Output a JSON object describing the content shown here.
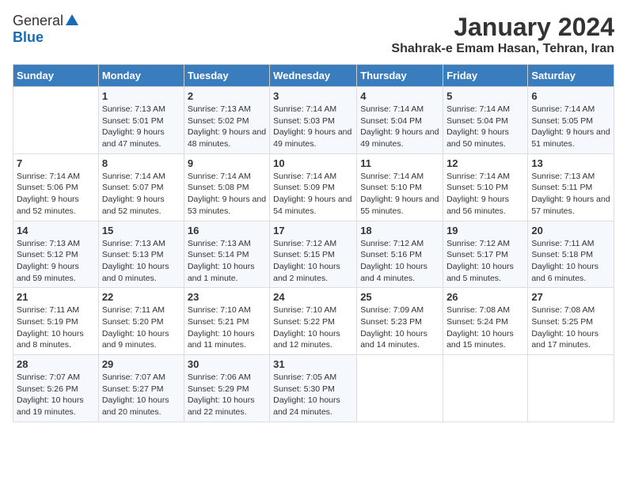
{
  "logo": {
    "general": "General",
    "blue": "Blue"
  },
  "title": "January 2024",
  "subtitle": "Shahrak-e Emam Hasan, Tehran, Iran",
  "days_header": [
    "Sunday",
    "Monday",
    "Tuesday",
    "Wednesday",
    "Thursday",
    "Friday",
    "Saturday"
  ],
  "weeks": [
    [
      {
        "day": "",
        "sunrise": "",
        "sunset": "",
        "daylight": ""
      },
      {
        "day": "1",
        "sunrise": "Sunrise: 7:13 AM",
        "sunset": "Sunset: 5:01 PM",
        "daylight": "Daylight: 9 hours and 47 minutes."
      },
      {
        "day": "2",
        "sunrise": "Sunrise: 7:13 AM",
        "sunset": "Sunset: 5:02 PM",
        "daylight": "Daylight: 9 hours and 48 minutes."
      },
      {
        "day": "3",
        "sunrise": "Sunrise: 7:14 AM",
        "sunset": "Sunset: 5:03 PM",
        "daylight": "Daylight: 9 hours and 49 minutes."
      },
      {
        "day": "4",
        "sunrise": "Sunrise: 7:14 AM",
        "sunset": "Sunset: 5:04 PM",
        "daylight": "Daylight: 9 hours and 49 minutes."
      },
      {
        "day": "5",
        "sunrise": "Sunrise: 7:14 AM",
        "sunset": "Sunset: 5:04 PM",
        "daylight": "Daylight: 9 hours and 50 minutes."
      },
      {
        "day": "6",
        "sunrise": "Sunrise: 7:14 AM",
        "sunset": "Sunset: 5:05 PM",
        "daylight": "Daylight: 9 hours and 51 minutes."
      }
    ],
    [
      {
        "day": "7",
        "sunrise": "Sunrise: 7:14 AM",
        "sunset": "Sunset: 5:06 PM",
        "daylight": "Daylight: 9 hours and 52 minutes."
      },
      {
        "day": "8",
        "sunrise": "Sunrise: 7:14 AM",
        "sunset": "Sunset: 5:07 PM",
        "daylight": "Daylight: 9 hours and 52 minutes."
      },
      {
        "day": "9",
        "sunrise": "Sunrise: 7:14 AM",
        "sunset": "Sunset: 5:08 PM",
        "daylight": "Daylight: 9 hours and 53 minutes."
      },
      {
        "day": "10",
        "sunrise": "Sunrise: 7:14 AM",
        "sunset": "Sunset: 5:09 PM",
        "daylight": "Daylight: 9 hours and 54 minutes."
      },
      {
        "day": "11",
        "sunrise": "Sunrise: 7:14 AM",
        "sunset": "Sunset: 5:10 PM",
        "daylight": "Daylight: 9 hours and 55 minutes."
      },
      {
        "day": "12",
        "sunrise": "Sunrise: 7:14 AM",
        "sunset": "Sunset: 5:10 PM",
        "daylight": "Daylight: 9 hours and 56 minutes."
      },
      {
        "day": "13",
        "sunrise": "Sunrise: 7:13 AM",
        "sunset": "Sunset: 5:11 PM",
        "daylight": "Daylight: 9 hours and 57 minutes."
      }
    ],
    [
      {
        "day": "14",
        "sunrise": "Sunrise: 7:13 AM",
        "sunset": "Sunset: 5:12 PM",
        "daylight": "Daylight: 9 hours and 59 minutes."
      },
      {
        "day": "15",
        "sunrise": "Sunrise: 7:13 AM",
        "sunset": "Sunset: 5:13 PM",
        "daylight": "Daylight: 10 hours and 0 minutes."
      },
      {
        "day": "16",
        "sunrise": "Sunrise: 7:13 AM",
        "sunset": "Sunset: 5:14 PM",
        "daylight": "Daylight: 10 hours and 1 minute."
      },
      {
        "day": "17",
        "sunrise": "Sunrise: 7:12 AM",
        "sunset": "Sunset: 5:15 PM",
        "daylight": "Daylight: 10 hours and 2 minutes."
      },
      {
        "day": "18",
        "sunrise": "Sunrise: 7:12 AM",
        "sunset": "Sunset: 5:16 PM",
        "daylight": "Daylight: 10 hours and 4 minutes."
      },
      {
        "day": "19",
        "sunrise": "Sunrise: 7:12 AM",
        "sunset": "Sunset: 5:17 PM",
        "daylight": "Daylight: 10 hours and 5 minutes."
      },
      {
        "day": "20",
        "sunrise": "Sunrise: 7:11 AM",
        "sunset": "Sunset: 5:18 PM",
        "daylight": "Daylight: 10 hours and 6 minutes."
      }
    ],
    [
      {
        "day": "21",
        "sunrise": "Sunrise: 7:11 AM",
        "sunset": "Sunset: 5:19 PM",
        "daylight": "Daylight: 10 hours and 8 minutes."
      },
      {
        "day": "22",
        "sunrise": "Sunrise: 7:11 AM",
        "sunset": "Sunset: 5:20 PM",
        "daylight": "Daylight: 10 hours and 9 minutes."
      },
      {
        "day": "23",
        "sunrise": "Sunrise: 7:10 AM",
        "sunset": "Sunset: 5:21 PM",
        "daylight": "Daylight: 10 hours and 11 minutes."
      },
      {
        "day": "24",
        "sunrise": "Sunrise: 7:10 AM",
        "sunset": "Sunset: 5:22 PM",
        "daylight": "Daylight: 10 hours and 12 minutes."
      },
      {
        "day": "25",
        "sunrise": "Sunrise: 7:09 AM",
        "sunset": "Sunset: 5:23 PM",
        "daylight": "Daylight: 10 hours and 14 minutes."
      },
      {
        "day": "26",
        "sunrise": "Sunrise: 7:08 AM",
        "sunset": "Sunset: 5:24 PM",
        "daylight": "Daylight: 10 hours and 15 minutes."
      },
      {
        "day": "27",
        "sunrise": "Sunrise: 7:08 AM",
        "sunset": "Sunset: 5:25 PM",
        "daylight": "Daylight: 10 hours and 17 minutes."
      }
    ],
    [
      {
        "day": "28",
        "sunrise": "Sunrise: 7:07 AM",
        "sunset": "Sunset: 5:26 PM",
        "daylight": "Daylight: 10 hours and 19 minutes."
      },
      {
        "day": "29",
        "sunrise": "Sunrise: 7:07 AM",
        "sunset": "Sunset: 5:27 PM",
        "daylight": "Daylight: 10 hours and 20 minutes."
      },
      {
        "day": "30",
        "sunrise": "Sunrise: 7:06 AM",
        "sunset": "Sunset: 5:29 PM",
        "daylight": "Daylight: 10 hours and 22 minutes."
      },
      {
        "day": "31",
        "sunrise": "Sunrise: 7:05 AM",
        "sunset": "Sunset: 5:30 PM",
        "daylight": "Daylight: 10 hours and 24 minutes."
      },
      {
        "day": "",
        "sunrise": "",
        "sunset": "",
        "daylight": ""
      },
      {
        "day": "",
        "sunrise": "",
        "sunset": "",
        "daylight": ""
      },
      {
        "day": "",
        "sunrise": "",
        "sunset": "",
        "daylight": ""
      }
    ]
  ]
}
